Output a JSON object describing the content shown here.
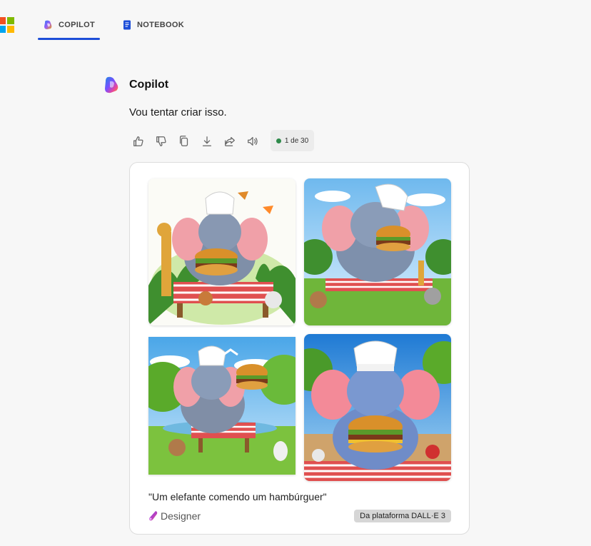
{
  "tabs": [
    {
      "label": "COPILOT",
      "active": true
    },
    {
      "label": "NOTEBOOK",
      "active": false
    }
  ],
  "message": {
    "bot_name": "Copilot",
    "text": "Vou tentar criar isso.",
    "counter": "1 de 30",
    "counter_status_color": "#2e8a4a"
  },
  "actions": [
    "thumbs-up-icon",
    "thumbs-down-icon",
    "copy-icon",
    "download-icon",
    "share-icon",
    "speaker-icon"
  ],
  "card": {
    "prompt": "\"Um elefante comendo um hambúrguer\"",
    "designer_label": "Designer",
    "platform_badge": "Da plataforma DALL·E 3"
  },
  "colors": {
    "accent": "#1d4ed8",
    "background": "#f7f7f7",
    "card": "#ffffff"
  }
}
